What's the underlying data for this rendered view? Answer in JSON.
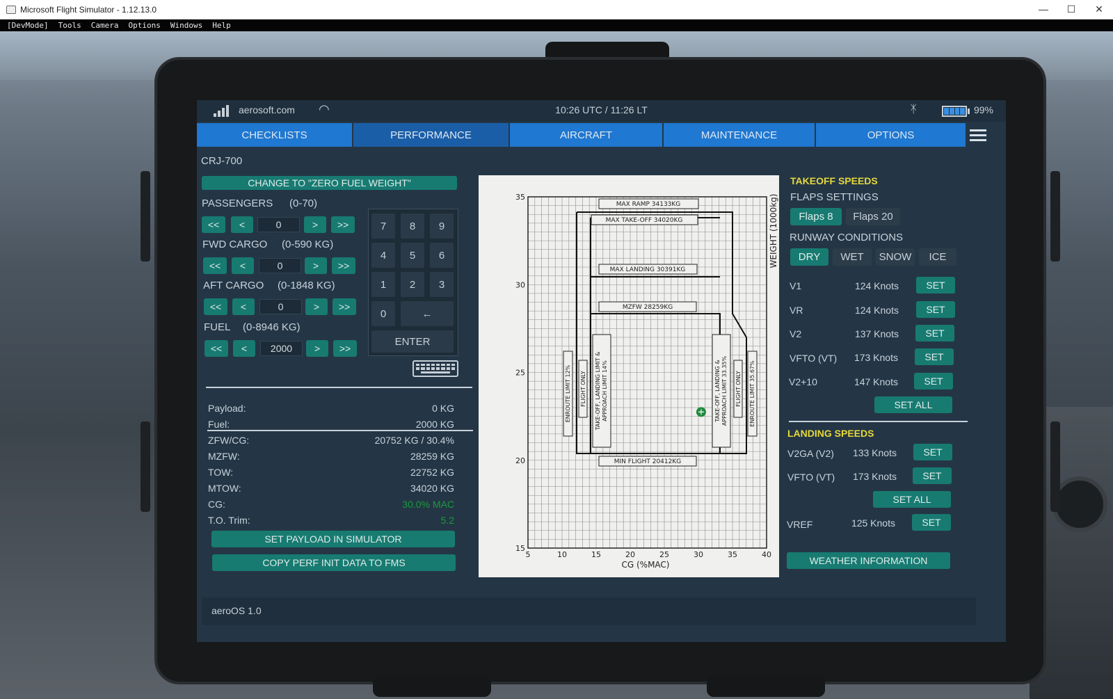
{
  "window": {
    "title": "Microsoft Flight Simulator - 1.12.13.0",
    "controls": [
      "—",
      "☐",
      "✕"
    ]
  },
  "menubar": [
    "[DevMode]",
    "Tools",
    "Camera",
    "Options",
    "Windows",
    "Help"
  ],
  "status": {
    "host": "aerosoft.com",
    "clock": "10:26 UTC / 11:26 LT",
    "battery": "99%"
  },
  "tabs": [
    "CHECKLISTS",
    "PERFORMANCE",
    "AIRCRAFT",
    "MAINTENANCE",
    "OPTIONS"
  ],
  "active_tab": "PERFORMANCE",
  "left": {
    "aircraft": "CRJ-700",
    "change_button": "CHANGE TO \"ZERO FUEL WEIGHT\"",
    "passengers": {
      "label": "PASSENGERS",
      "range": "(0-70)",
      "value": "0"
    },
    "fwd_cargo": {
      "label": "FWD CARGO",
      "range": "(0-590 KG)",
      "value": "0"
    },
    "aft_cargo": {
      "label": "AFT CARGO",
      "range": "(0-1848 KG)",
      "value": "0"
    },
    "fuel": {
      "label": "FUEL",
      "range": "(0-8946 KG)",
      "value": "2000"
    },
    "stepper": {
      "dec2": "<<",
      "dec1": "<",
      "inc1": ">",
      "inc2": ">>"
    },
    "keypad": {
      "keys": [
        "7",
        "8",
        "9",
        "4",
        "5",
        "6",
        "1",
        "2",
        "3",
        "0",
        "←"
      ],
      "enter": "ENTER"
    },
    "summary": [
      {
        "label": "Payload:",
        "value": "0 KG"
      },
      {
        "label": "Fuel:",
        "value": "2000 KG"
      },
      {
        "label": "ZFW/CG:",
        "value": "20752 KG / 30.4%"
      },
      {
        "label": "MZFW:",
        "value": "28259 KG"
      },
      {
        "label": "TOW:",
        "value": "22752 KG"
      },
      {
        "label": "MTOW:",
        "value": "34020 KG"
      },
      {
        "label": "CG:",
        "value": "30.0% MAC"
      },
      {
        "label": "T.O. Trim:",
        "value": "5.2"
      }
    ],
    "set_payload": "SET PAYLOAD IN SIMULATOR",
    "copy_perf": "COPY PERF INIT DATA TO FMS"
  },
  "chart": {
    "xlabel": "CG (%MAC)",
    "ylabel": "WEIGHT (1000kg)",
    "xticks": [
      "5",
      "10",
      "15",
      "20",
      "25",
      "30",
      "35",
      "40"
    ],
    "yticks": [
      "35",
      "30",
      "25",
      "20",
      "15"
    ],
    "labels": {
      "max_ramp": "MAX RAMP 34133KG",
      "max_takeoff": "MAX TAKE-OFF 34020KG",
      "max_landing": "MAX LANDING 30391KG",
      "mzfw": "MZFW 28259KG",
      "min_flight": "MIN FLIGHT 20412KG",
      "enroute_12": "ENROUTE LIMIT 12%",
      "flight_only_l": "FLIGHT ONLY",
      "to_ldg_fwd_1": "TAKE-OFF, LANDING LIMIT &",
      "to_ldg_fwd_2": "APPROACH LIMIT 14%",
      "to_ldg_aft_1": "TAKE-OFF, LANDING &",
      "to_ldg_aft_2": "APPROACH LIMIT 33.35%",
      "flight_only_r": "FLIGHT ONLY",
      "enroute_35": "ENROUTE LIMIT 35.67%"
    }
  },
  "chart_data": {
    "type": "scatter",
    "xlabel": "CG (%MAC)",
    "ylabel": "WEIGHT (1000kg)",
    "xlim": [
      5,
      40
    ],
    "ylim": [
      15,
      35
    ],
    "points": [
      {
        "x": 30.4,
        "y": 22.75
      }
    ]
  },
  "right": {
    "takeoff_title": "TAKEOFF SPEEDS",
    "flaps_title": "FLAPS SETTINGS",
    "flaps": [
      "Flaps 8",
      "Flaps 20"
    ],
    "flaps_selected": "Flaps 8",
    "runway_title": "RUNWAY CONDITIONS",
    "runway": [
      "DRY",
      "WET",
      "SNOW",
      "ICE"
    ],
    "runway_selected": "DRY",
    "takeoff_speeds": [
      {
        "name": "V1",
        "value": "124 Knots"
      },
      {
        "name": "VR",
        "value": "124 Knots"
      },
      {
        "name": "V2",
        "value": "137 Knots"
      },
      {
        "name": "VFTO (VT)",
        "value": "173 Knots"
      },
      {
        "name": "V2+10",
        "value": "147 Knots"
      }
    ],
    "set": "SET",
    "set_all": "SET ALL",
    "landing_title": "LANDING SPEEDS",
    "landing_speeds": [
      {
        "name": "V2GA (V2)",
        "value": "133 Knots"
      },
      {
        "name": "VFTO (VT)",
        "value": "173 Knots"
      }
    ],
    "vref": {
      "name": "VREF",
      "value": "125 Knots"
    },
    "weather": "WEATHER INFORMATION"
  },
  "footer": "aeroOS 1.0"
}
